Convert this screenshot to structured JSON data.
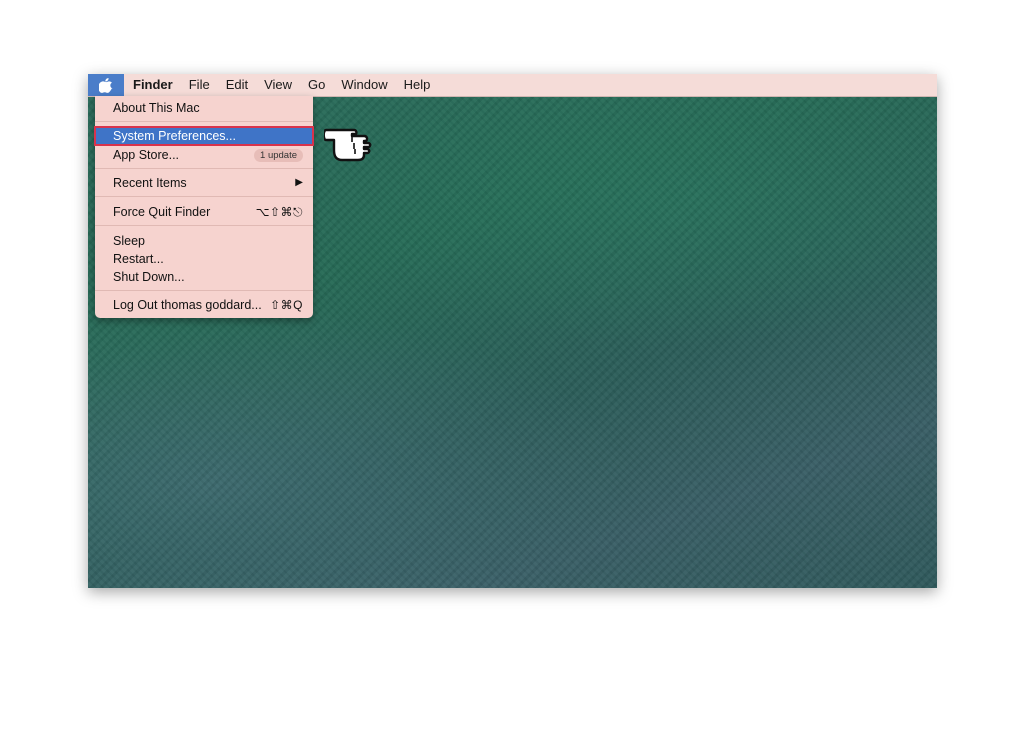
{
  "menubar": {
    "apple_icon": "apple-logo-icon",
    "items": [
      "Finder",
      "File",
      "Edit",
      "View",
      "Go",
      "Window",
      "Help"
    ]
  },
  "apple_menu": {
    "about": "About This Mac",
    "system_preferences": "System Preferences...",
    "app_store": "App Store...",
    "app_store_badge": "1 update",
    "recent_items": "Recent Items",
    "recent_items_arrow": "▶",
    "force_quit": "Force Quit Finder",
    "force_quit_shortcut": "⌥⇧⌘⎋",
    "sleep": "Sleep",
    "restart": "Restart...",
    "shut_down": "Shut Down...",
    "log_out": "Log Out thomas goddard...",
    "log_out_shortcut": "⇧⌘Q"
  },
  "pointer": {
    "icon": "pointing-hand-icon"
  },
  "colors": {
    "menubar_bg": "#f5dcd8",
    "menu_bg": "#f6d3cf",
    "selection": "#3f74c7",
    "highlight_outline": "#d8334c",
    "desktop": "#2a6b5b"
  }
}
